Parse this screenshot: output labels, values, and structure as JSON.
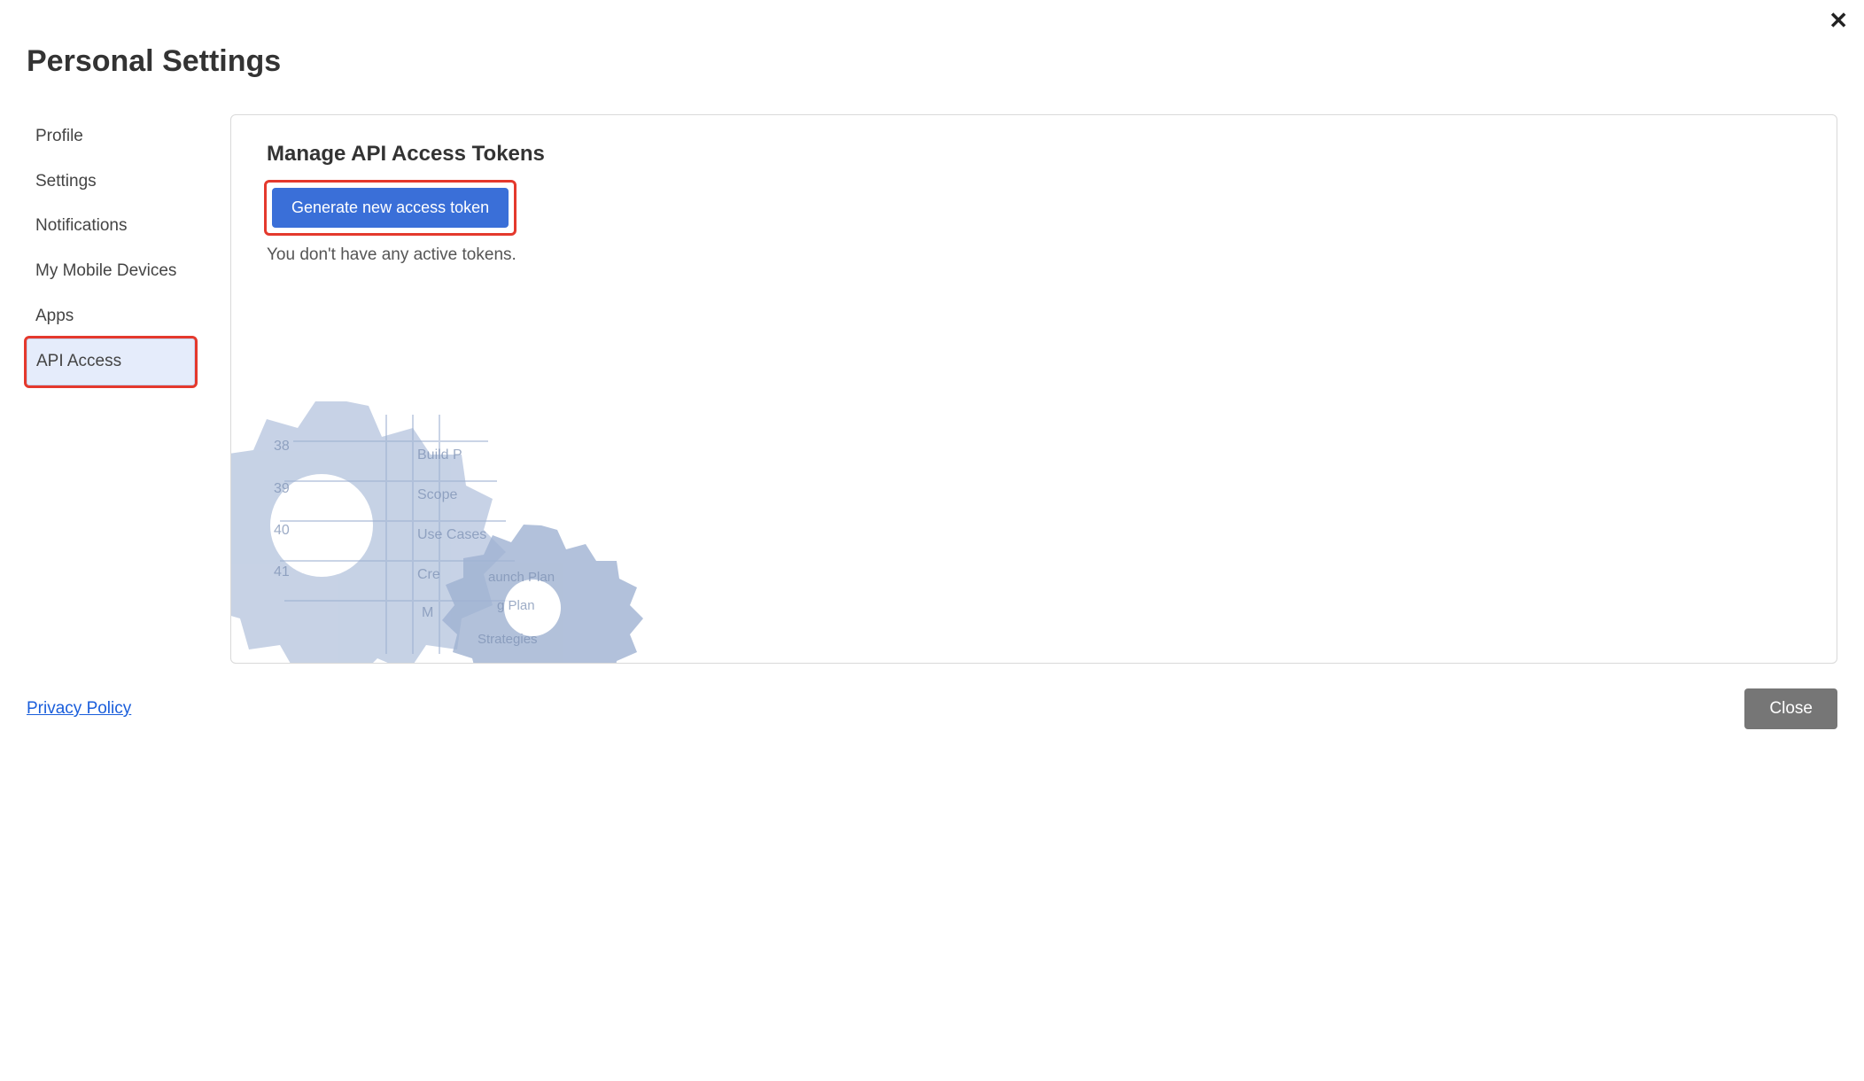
{
  "header": {
    "title": "Personal Settings",
    "close_glyph": "✕"
  },
  "sidebar": {
    "items": [
      {
        "label": "Profile",
        "active": false
      },
      {
        "label": "Settings",
        "active": false
      },
      {
        "label": "Notifications",
        "active": false
      },
      {
        "label": "My Mobile Devices",
        "active": false
      },
      {
        "label": "Apps",
        "active": false
      },
      {
        "label": "API Access",
        "active": true
      }
    ]
  },
  "panel": {
    "title": "Manage API Access Tokens",
    "generate_label": "Generate new access token",
    "empty_message": "You don't have any active tokens."
  },
  "footer": {
    "privacy_label": "Privacy Policy",
    "close_label": "Close"
  }
}
